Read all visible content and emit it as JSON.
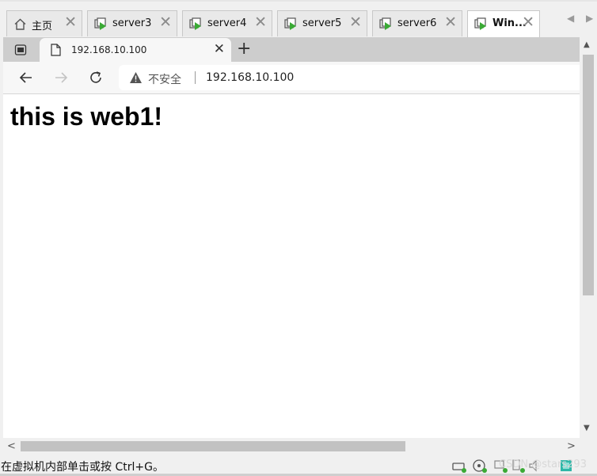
{
  "vm_tabs": [
    {
      "label": "主页",
      "icon": "home-icon",
      "active": false
    },
    {
      "label": "server3",
      "icon": "vm-icon",
      "active": false
    },
    {
      "label": "server4",
      "icon": "vm-icon",
      "active": false
    },
    {
      "label": "server5",
      "icon": "vm-icon",
      "active": false
    },
    {
      "label": "server6",
      "icon": "vm-icon",
      "active": false
    },
    {
      "label": "Win...",
      "icon": "vm-icon",
      "active": true
    }
  ],
  "browser": {
    "tab_title": "192.168.10.100",
    "security_label": "不安全",
    "address": "192.168.10.100"
  },
  "page": {
    "heading": "this is web1!"
  },
  "statusbar": {
    "hint": "在虚拟机内部单击或按 Ctrl+G。",
    "watermark": "CSDN @stars293"
  },
  "colors": {
    "vm_icon_green": "#3aaa35",
    "page_background": "#ffffff",
    "chrome_gray": "#cdcdcd"
  }
}
